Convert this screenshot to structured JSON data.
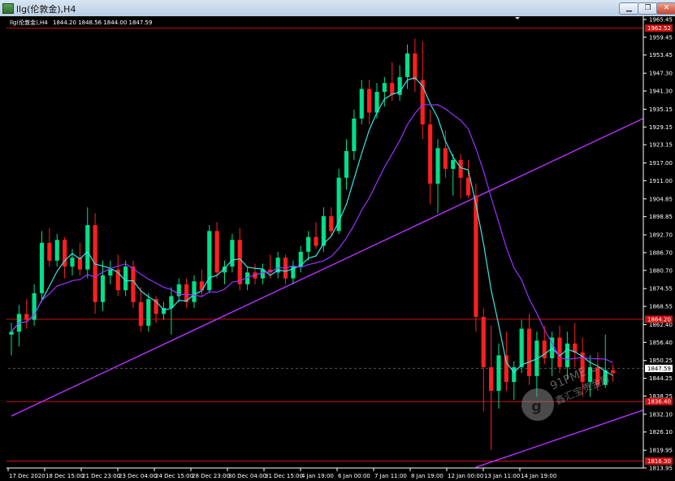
{
  "window": {
    "title": "llg(伦敦金),H4",
    "buttons": [
      "minimize",
      "restore",
      "close"
    ]
  },
  "ohlc_line": {
    "symbol": "llg(伦敦金),H4",
    "values": "1844.20 1848.56 1844.00 1847.59"
  },
  "colors": {
    "background": "#000000",
    "bull": "#00e08a",
    "bear": "#ff1f1f",
    "ma_fast": "#39e6e6",
    "ma_slow": "#9933ff",
    "trendline": "#b833ff",
    "hline": "#cc1010",
    "grid": "#555555",
    "axis_text": "#ffffff",
    "price_tag": "#cc1010",
    "current_tag": "#ffffff"
  },
  "watermark": {
    "line1": "91PME.COM",
    "line2": "鑫汇宝贵金属"
  },
  "chart_data": {
    "type": "candlestick",
    "symbol": "llg(伦敦金)",
    "timeframe": "H4",
    "ylim": [
      1813.95,
      1966.0
    ],
    "y_ticks": [
      "1965.45",
      "1959.45",
      "1953.45",
      "1947.30",
      "1941.30",
      "1935.15",
      "1929.15",
      "1923.15",
      "1917.00",
      "1911.00",
      "1904.85",
      "1898.85",
      "1892.70",
      "1886.70",
      "1880.70",
      "1874.55",
      "1868.55",
      "1862.40",
      "1856.40",
      "1850.25",
      "1844.25",
      "1838.25",
      "1832.10",
      "1826.10",
      "1819.95",
      "1813.95"
    ],
    "x_ticks": [
      "17 Dec 2020",
      "18 Dec 15:00",
      "21 Dec 23:00",
      "23 Dec 04:00",
      "24 Dec 15:00",
      "28 Dec 23:00",
      "30 Dec 04:00",
      "31 Dec 15:00",
      "4 Jan 19:00",
      "6 Jan 00:00",
      "7 Jan 11:00",
      "8 Jan 19:00",
      "12 Jan 00:00",
      "13 Jan 11:00",
      "14 Jan 19:00"
    ],
    "current_price": "1847.59",
    "horizontal_levels": [
      {
        "price": 1962.5,
        "label": "1962.52"
      },
      {
        "price": 1864.2,
        "label": "1864.20"
      },
      {
        "price": 1836.4,
        "label": "1836.40"
      },
      {
        "price": 1816.3,
        "label": "1816.30"
      }
    ],
    "price_tags": [
      "1962.52",
      "1864.20",
      "1847.59",
      "1836.40",
      "1816.30"
    ],
    "trendlines": [
      {
        "from": {
          "bar": 0,
          "price": 1831.5
        },
        "to": {
          "bar": 104,
          "price": 1957.5
        }
      },
      {
        "from": {
          "bar": 61,
          "price": 1814.2
        },
        "to": {
          "bar": 104,
          "price": 1852.0
        }
      }
    ],
    "candles": [
      [
        1859,
        1863,
        1852,
        1860
      ],
      [
        1860,
        1869,
        1855,
        1866
      ],
      [
        1866,
        1871,
        1861,
        1864
      ],
      [
        1864,
        1876,
        1862,
        1873
      ],
      [
        1873,
        1894,
        1870,
        1890
      ],
      [
        1890,
        1895,
        1882,
        1884
      ],
      [
        1884,
        1893,
        1882,
        1891
      ],
      [
        1891,
        1892,
        1878,
        1882
      ],
      [
        1882,
        1888,
        1879,
        1885
      ],
      [
        1885,
        1890,
        1879,
        1881
      ],
      [
        1881,
        1902,
        1878,
        1896
      ],
      [
        1896,
        1900,
        1866,
        1870
      ],
      [
        1870,
        1884,
        1867,
        1879
      ],
      [
        1879,
        1884,
        1876,
        1881
      ],
      [
        1881,
        1886,
        1872,
        1874
      ],
      [
        1874,
        1884,
        1872,
        1882
      ],
      [
        1882,
        1884,
        1868,
        1870
      ],
      [
        1870,
        1875,
        1860,
        1862
      ],
      [
        1862,
        1873,
        1860,
        1871
      ],
      [
        1871,
        1872,
        1863,
        1866
      ],
      [
        1866,
        1870,
        1864,
        1868
      ],
      [
        1868,
        1875,
        1859,
        1872
      ],
      [
        1872,
        1878,
        1870,
        1876
      ],
      [
        1876,
        1878,
        1868,
        1870
      ],
      [
        1870,
        1879,
        1868,
        1877
      ],
      [
        1877,
        1881,
        1872,
        1874
      ],
      [
        1874,
        1896,
        1873,
        1894
      ],
      [
        1894,
        1897,
        1878,
        1880
      ],
      [
        1880,
        1884,
        1876,
        1882
      ],
      [
        1882,
        1893,
        1880,
        1891
      ],
      [
        1891,
        1895,
        1874,
        1876
      ],
      [
        1876,
        1882,
        1874,
        1880
      ],
      [
        1880,
        1883,
        1876,
        1878
      ],
      [
        1878,
        1883,
        1876,
        1881
      ],
      [
        1881,
        1886,
        1878,
        1880
      ],
      [
        1880,
        1887,
        1878,
        1885
      ],
      [
        1885,
        1886,
        1876,
        1878
      ],
      [
        1878,
        1884,
        1876,
        1882
      ],
      [
        1882,
        1889,
        1880,
        1887
      ],
      [
        1887,
        1894,
        1884,
        1892
      ],
      [
        1892,
        1897,
        1888,
        1889
      ],
      [
        1889,
        1902,
        1887,
        1899
      ],
      [
        1899,
        1902,
        1892,
        1894
      ],
      [
        1894,
        1915,
        1893,
        1912
      ],
      [
        1912,
        1925,
        1908,
        1921
      ],
      [
        1921,
        1935,
        1918,
        1932
      ],
      [
        1932,
        1945,
        1930,
        1942
      ],
      [
        1942,
        1945,
        1930,
        1934
      ],
      [
        1934,
        1944,
        1932,
        1941
      ],
      [
        1941,
        1946,
        1936,
        1944
      ],
      [
        1944,
        1951,
        1938,
        1940
      ],
      [
        1940,
        1950,
        1938,
        1946
      ],
      [
        1946,
        1957,
        1942,
        1954
      ],
      [
        1954,
        1959,
        1941,
        1945
      ],
      [
        1945,
        1958,
        1925,
        1930
      ],
      [
        1930,
        1935,
        1903,
        1910
      ],
      [
        1910,
        1925,
        1900,
        1922
      ],
      [
        1922,
        1928,
        1912,
        1915
      ],
      [
        1915,
        1920,
        1906,
        1918
      ],
      [
        1918,
        1920,
        1905,
        1912
      ],
      [
        1912,
        1918,
        1905,
        1906
      ],
      [
        1906,
        1910,
        1860,
        1865
      ],
      [
        1865,
        1868,
        1833,
        1848
      ],
      [
        1848,
        1862,
        1820,
        1840
      ],
      [
        1840,
        1856,
        1834,
        1852
      ],
      [
        1852,
        1860,
        1840,
        1843
      ],
      [
        1843,
        1850,
        1837,
        1848
      ],
      [
        1848,
        1864,
        1846,
        1861
      ],
      [
        1861,
        1866,
        1842,
        1845
      ],
      [
        1845,
        1860,
        1838,
        1857
      ],
      [
        1857,
        1862,
        1849,
        1851
      ],
      [
        1851,
        1860,
        1845,
        1858
      ],
      [
        1858,
        1862,
        1846,
        1848
      ],
      [
        1848,
        1860,
        1844,
        1856
      ],
      [
        1856,
        1863,
        1848,
        1853
      ],
      [
        1853,
        1858,
        1838,
        1843
      ],
      [
        1843,
        1852,
        1838,
        1848
      ],
      [
        1848,
        1853,
        1840,
        1842
      ],
      [
        1842,
        1859,
        1841,
        1847
      ],
      [
        1847,
        1849,
        1843,
        1846
      ]
    ],
    "ma_fast": {
      "name": "",
      "period": "short",
      "note": "cyan moving average"
    },
    "ma_slow": {
      "name": "",
      "period": "long",
      "note": "purple moving average"
    }
  }
}
